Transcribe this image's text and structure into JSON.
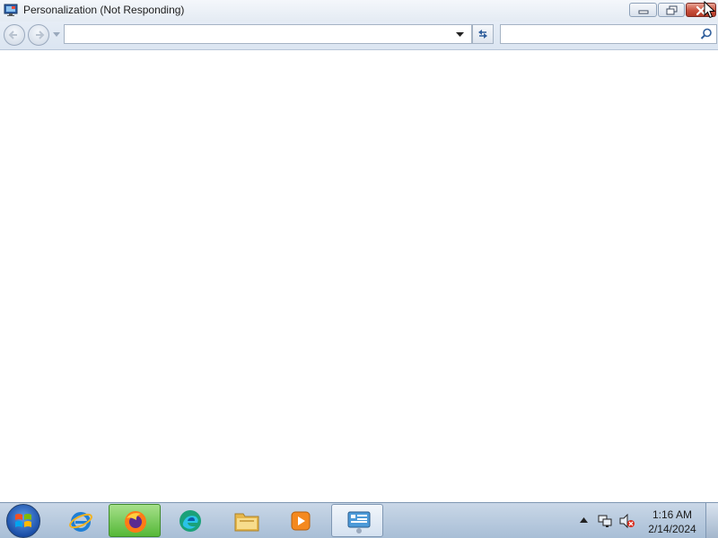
{
  "window": {
    "title": "Personalization (Not Responding)",
    "controls": {
      "minimize_icon": "minimize-icon",
      "maximize_icon": "restore-icon",
      "close_icon": "close-icon",
      "close_color": "#c9503c"
    }
  },
  "navbar": {
    "back_icon": "back-arrow-icon",
    "forward_icon": "forward-arrow-icon",
    "address_value": "",
    "address_placeholder": "",
    "refresh_icon": "refresh-icon",
    "search_value": "",
    "search_placeholder": "",
    "search_icon": "search-icon"
  },
  "taskbar": {
    "start_icon": "windows-start-orb",
    "pinned": [
      {
        "name": "internet-explorer",
        "icon": "ie-icon",
        "active": false
      },
      {
        "name": "firefox",
        "icon": "firefox-icon",
        "active": true,
        "accent": "#55b838"
      },
      {
        "name": "edge",
        "icon": "edge-icon",
        "active": false
      },
      {
        "name": "file-explorer",
        "icon": "folder-icon",
        "active": false
      },
      {
        "name": "media-player",
        "icon": "media-player-icon",
        "active": false
      },
      {
        "name": "control-panel",
        "icon": "control-panel-icon",
        "active": true
      }
    ],
    "tray": {
      "time": "1:16 AM",
      "date": "2/14/2024",
      "network_icon": "network-icon",
      "volume_icon": "volume-muted-icon"
    }
  },
  "colors": {
    "titlebar": "#e4ebf3",
    "taskbar": "#a8bed6",
    "content_bg": "#ffffff"
  }
}
